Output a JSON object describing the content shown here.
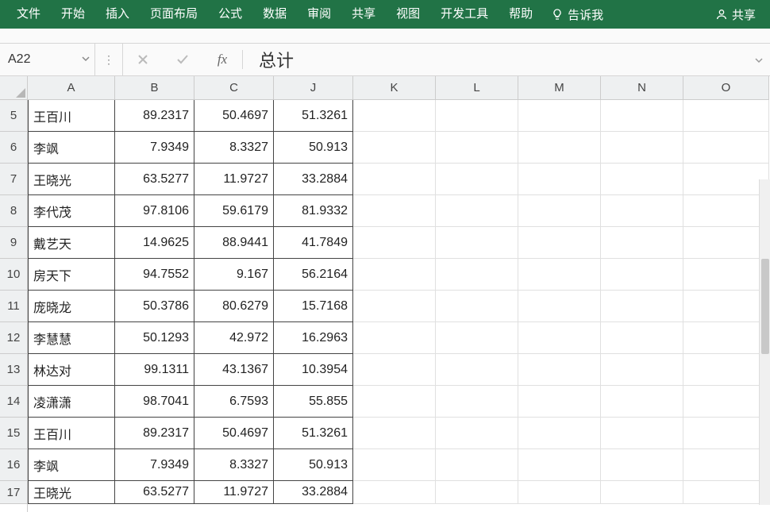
{
  "menu": {
    "file": "文件",
    "start": "开始",
    "insert": "插入",
    "layout": "页面布局",
    "formula": "公式",
    "data": "数据",
    "review": "审阅",
    "share": "共享",
    "view": "视图",
    "dev": "开发工具",
    "help": "帮助",
    "tellme": "告诉我",
    "share_right": "共享"
  },
  "namebox": "A22",
  "formula_value": "总计",
  "columns": [
    "A",
    "B",
    "C",
    "J",
    "K",
    "L",
    "M",
    "N",
    "O"
  ],
  "row_numbers": [
    "5",
    "6",
    "7",
    "8",
    "9",
    "10",
    "11",
    "12",
    "13",
    "14",
    "15",
    "16",
    "17"
  ],
  "rows": [
    {
      "a": "王百川",
      "b": "89.2317",
      "c": "50.4697",
      "j": "51.3261"
    },
    {
      "a": "李飒",
      "b": "7.9349",
      "c": "8.3327",
      "j": "50.913"
    },
    {
      "a": "王晓光",
      "b": "63.5277",
      "c": "11.9727",
      "j": "33.2884"
    },
    {
      "a": "李代茂",
      "b": "97.8106",
      "c": "59.6179",
      "j": "81.9332"
    },
    {
      "a": "戴艺天",
      "b": "14.9625",
      "c": "88.9441",
      "j": "41.7849"
    },
    {
      "a": "房天下",
      "b": "94.7552",
      "c": "9.167",
      "j": "56.2164"
    },
    {
      "a": "庞晓龙",
      "b": "50.3786",
      "c": "80.6279",
      "j": "15.7168"
    },
    {
      "a": "李慧慧",
      "b": "50.1293",
      "c": "42.972",
      "j": "16.2963"
    },
    {
      "a": "林达对",
      "b": "99.1311",
      "c": "43.1367",
      "j": "10.3954"
    },
    {
      "a": "凌潇潇",
      "b": "98.7041",
      "c": "6.7593",
      "j": "55.855"
    },
    {
      "a": "王百川",
      "b": "89.2317",
      "c": "50.4697",
      "j": "51.3261"
    },
    {
      "a": "李飒",
      "b": "7.9349",
      "c": "8.3327",
      "j": "50.913"
    },
    {
      "a": "王晓光",
      "b": "63.5277",
      "c": "11.9727",
      "j": "33.2884"
    }
  ]
}
